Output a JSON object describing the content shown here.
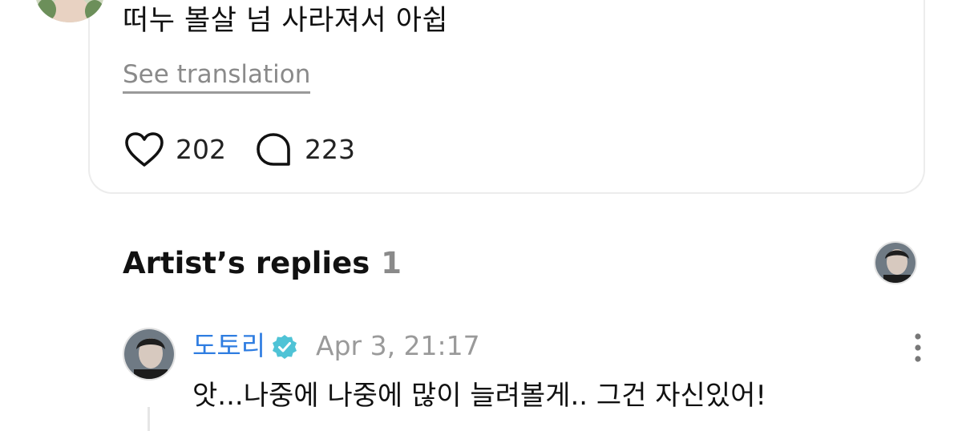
{
  "post": {
    "text": "떠누 볼살 넘 사라져서 아쉽",
    "see_translation": "See translation",
    "like_count": "202",
    "comment_count": "223"
  },
  "artist_replies": {
    "title": "Artist’s replies",
    "count": "1"
  },
  "reply": {
    "author": "도토리",
    "timestamp": "Apr 3, 21:17",
    "text": "앗...나중에 나중에 많이 늘려볼게.. 그건 자신있어!"
  },
  "icons": {
    "like": "heart-icon",
    "comment": "comment-bubble-icon",
    "verified": "verified-badge-icon",
    "more": "more-vertical-icon"
  },
  "colors": {
    "author": "#2f7de1",
    "verified": "#4fc3d6",
    "muted": "#8a8a8a"
  }
}
